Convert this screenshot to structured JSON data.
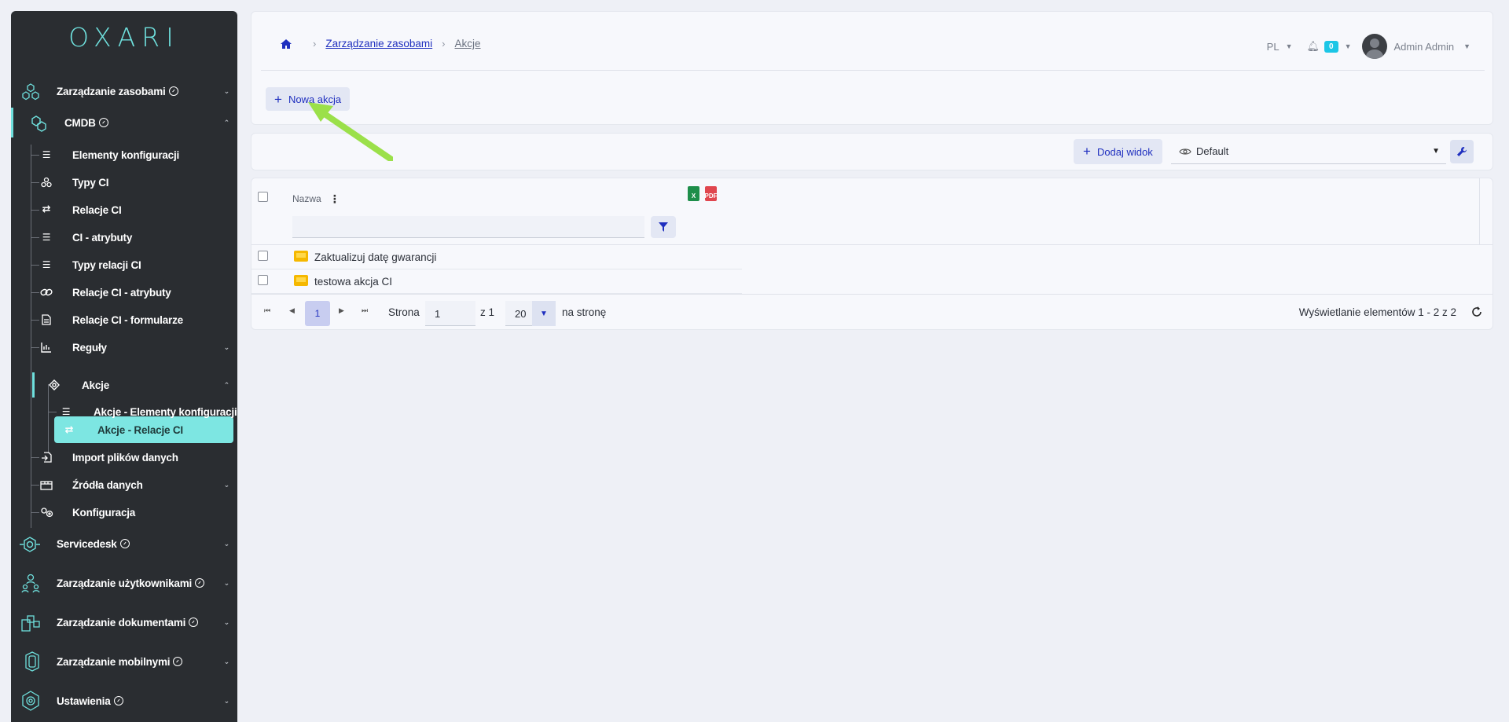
{
  "sidebar": {
    "logo": "OXARI",
    "items": [
      {
        "label": "Zarządzanie zasobami",
        "help": true
      },
      {
        "label": "CMDB",
        "help": true
      },
      {
        "label": "Elementy konfiguracji"
      },
      {
        "label": "Typy CI"
      },
      {
        "label": "Relacje CI"
      },
      {
        "label": "CI - atrybuty"
      },
      {
        "label": "Typy relacji CI"
      },
      {
        "label": "Relacje CI - atrybuty"
      },
      {
        "label": "Relacje CI - formularze"
      },
      {
        "label": "Reguły"
      },
      {
        "label": "Akcje"
      },
      {
        "label": "Akcje - Elementy konfiguracji"
      },
      {
        "label": "Akcje - Relacje CI"
      },
      {
        "label": "Import plików danych"
      },
      {
        "label": "Źródła danych"
      },
      {
        "label": "Konfiguracja"
      },
      {
        "label": "Servicedesk",
        "help": true
      },
      {
        "label": "Zarządzanie użytkownikami",
        "help": true
      },
      {
        "label": "Zarządzanie dokumentami",
        "help": true
      },
      {
        "label": "Zarządzanie mobilnymi",
        "help": true
      },
      {
        "label": "Ustawienia",
        "help": true
      }
    ]
  },
  "header": {
    "breadcrumb": [
      "Zarządzanie zasobami",
      "Akcje"
    ],
    "language": "PL",
    "notifications": "0",
    "user": "Admin Admin",
    "new_button": "Nowa akcja"
  },
  "viewbar": {
    "add_view": "Dodaj widok",
    "view_name": "Default"
  },
  "grid": {
    "column_name": "Nazwa",
    "export_xls": "X",
    "export_pdf": "PDF",
    "rows": [
      "Zaktualizuj datę gwarancji",
      "testowa akcja CI"
    ]
  },
  "pager": {
    "current_page": "1",
    "page_label": "Strona",
    "page_input": "1",
    "of_label": "z 1",
    "page_size": "20",
    "per_page_label": "na stronę",
    "info": "Wyświetlanie elementów 1 - 2 z 2"
  },
  "colors": {
    "sidebar_bg": "#2a2d31",
    "accent": "#6fe0dd",
    "link": "#1f2fbf",
    "badge": "#1cc6e6"
  }
}
